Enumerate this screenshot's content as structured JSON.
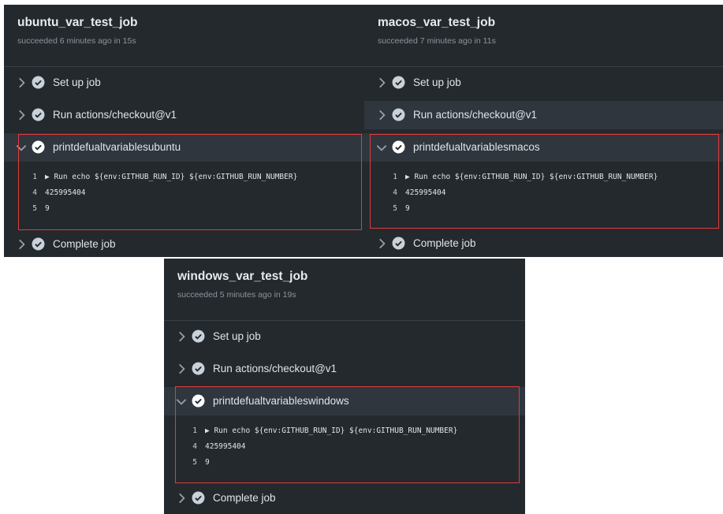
{
  "jobs": [
    {
      "title": "ubuntu_var_test_job",
      "subtitle": "succeeded 6 minutes ago in 15s",
      "steps": [
        {
          "label": "Set up job",
          "expanded": false
        },
        {
          "label": "Run actions/checkout@v1",
          "expanded": false
        },
        {
          "label": "printdefualtvariablesubuntu",
          "expanded": true
        },
        {
          "label": "Complete job",
          "expanded": false
        }
      ],
      "log": [
        {
          "num": "1",
          "text": "▶ Run echo ${env:GITHUB_RUN_ID} ${env:GITHUB_RUN_NUMBER}"
        },
        {
          "num": "4",
          "text": "425995404"
        },
        {
          "num": "5",
          "text": "9"
        }
      ]
    },
    {
      "title": "macos_var_test_job",
      "subtitle": "succeeded 7 minutes ago in 11s",
      "steps": [
        {
          "label": "Set up job",
          "expanded": false
        },
        {
          "label": "Run actions/checkout@v1",
          "expanded": false
        },
        {
          "label": "printdefualtvariablesmacos",
          "expanded": true
        },
        {
          "label": "Complete job",
          "expanded": false
        }
      ],
      "log": [
        {
          "num": "1",
          "text": "▶ Run echo ${env:GITHUB_RUN_ID} ${env:GITHUB_RUN_NUMBER}"
        },
        {
          "num": "4",
          "text": "425995404"
        },
        {
          "num": "5",
          "text": "9"
        }
      ]
    },
    {
      "title": "windows_var_test_job",
      "subtitle": "succeeded 5 minutes ago in 19s",
      "steps": [
        {
          "label": "Set up job",
          "expanded": false
        },
        {
          "label": "Run actions/checkout@v1",
          "expanded": false
        },
        {
          "label": "printdefualtvariableswindows",
          "expanded": true
        },
        {
          "label": "Complete job",
          "expanded": false
        }
      ],
      "log": [
        {
          "num": "1",
          "text": "▶ Run echo ${env:GITHUB_RUN_ID} ${env:GITHUB_RUN_NUMBER}"
        },
        {
          "num": "4",
          "text": "425995404"
        },
        {
          "num": "5",
          "text": "9"
        }
      ]
    }
  ],
  "icons": {
    "expand": "chevron-right-icon",
    "collapse": "chevron-down-icon",
    "status": "check-circle-icon"
  },
  "colors": {
    "panel_bg": "#24292e",
    "selected_row": "#2f363d",
    "highlight": "#e03c3c",
    "success_icon": "#c9d1d9"
  }
}
